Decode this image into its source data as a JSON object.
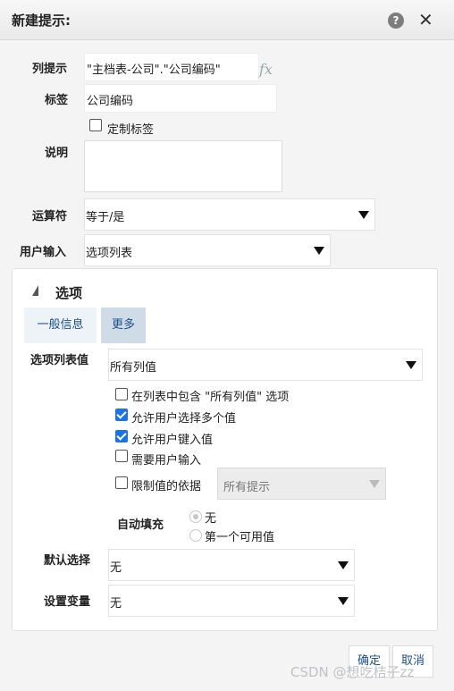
{
  "window": {
    "title": "新建提示:"
  },
  "fields": {
    "column_prompt_label": "列提示",
    "column_prompt_value": "\"主档表-公司\".\"公司编码\"",
    "tag_label": "标签",
    "tag_value": "公司编码",
    "custom_tag_label": "定制标签",
    "desc_label": "说明",
    "operator_label": "运算符",
    "operator_value": "等于/是",
    "user_input_label": "用户输入",
    "user_input_value": "选项列表"
  },
  "options": {
    "title": "选项",
    "tabs": [
      "一般信息",
      "更多"
    ],
    "list_values_label": "选项列表值",
    "list_values_value": "所有列值",
    "checkboxes": [
      "在列表中包含 \"所有列值\" 选项",
      "允许用户选择多个值",
      "允许用户键入值",
      "需要用户输入",
      "限制值的依据"
    ],
    "limit_select_value": "所有提示",
    "autofill_label": "自动填充",
    "autofill_opts": [
      "无",
      "第一个可用值"
    ],
    "default_label": "默认选择",
    "default_value": "无",
    "var_label": "设置变量",
    "var_value": "无"
  },
  "buttons": {
    "ok": "确定",
    "cancel": "取消"
  },
  "watermark": "CSDN @想吃桔子zz"
}
